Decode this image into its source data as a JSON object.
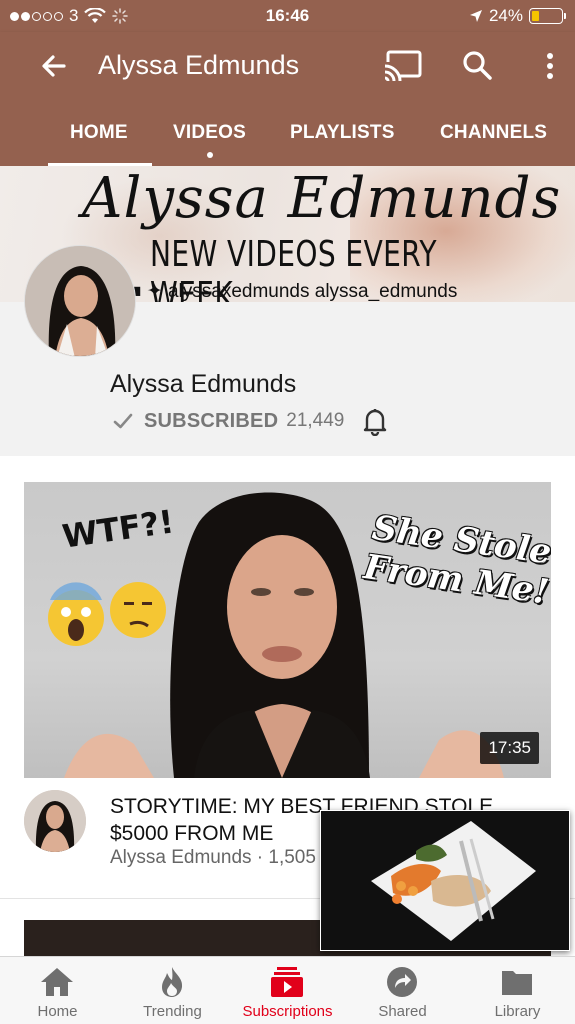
{
  "status_bar": {
    "carrier": "3",
    "time": "16:46",
    "battery_percent": "24%",
    "battery_level": 0.24
  },
  "app_bar": {
    "title": "Alyssa Edmunds",
    "tabs": [
      {
        "label": "HOME",
        "active": true
      },
      {
        "label": "VIDEOS",
        "active": false
      },
      {
        "label": "PLAYLISTS",
        "active": false
      },
      {
        "label": "CHANNELS",
        "active": false
      }
    ]
  },
  "channel": {
    "banner_script": "Alyssa Edmunds",
    "banner_tagline": "NEW VIDEOS EVERY WEEK",
    "banner_socials": "alyssaxedmunds   alyssa_edmunds",
    "name": "Alyssa Edmunds",
    "subscribed_label": "SUBSCRIBED",
    "subscriber_count": "21,449"
  },
  "video": {
    "thumbnail_text_left": "WTF?!",
    "thumbnail_text_right": "She Stole From Me!",
    "duration": "17:35",
    "title": "STORYTIME: MY BEST FRIEND STOLE $5000 FROM ME",
    "meta": "Alyssa Edmunds · 1,505"
  },
  "bottom_nav": {
    "items": [
      {
        "label": "Home",
        "icon": "home-icon",
        "active": false
      },
      {
        "label": "Trending",
        "icon": "trending-icon",
        "active": false
      },
      {
        "label": "Subscriptions",
        "icon": "subscriptions-icon",
        "active": true
      },
      {
        "label": "Shared",
        "icon": "shared-icon",
        "active": false
      },
      {
        "label": "Library",
        "icon": "library-icon",
        "active": false
      }
    ]
  },
  "colors": {
    "app_bar": "#94614f",
    "accent_red": "#e1001a",
    "battery_fill": "#f6c400"
  }
}
